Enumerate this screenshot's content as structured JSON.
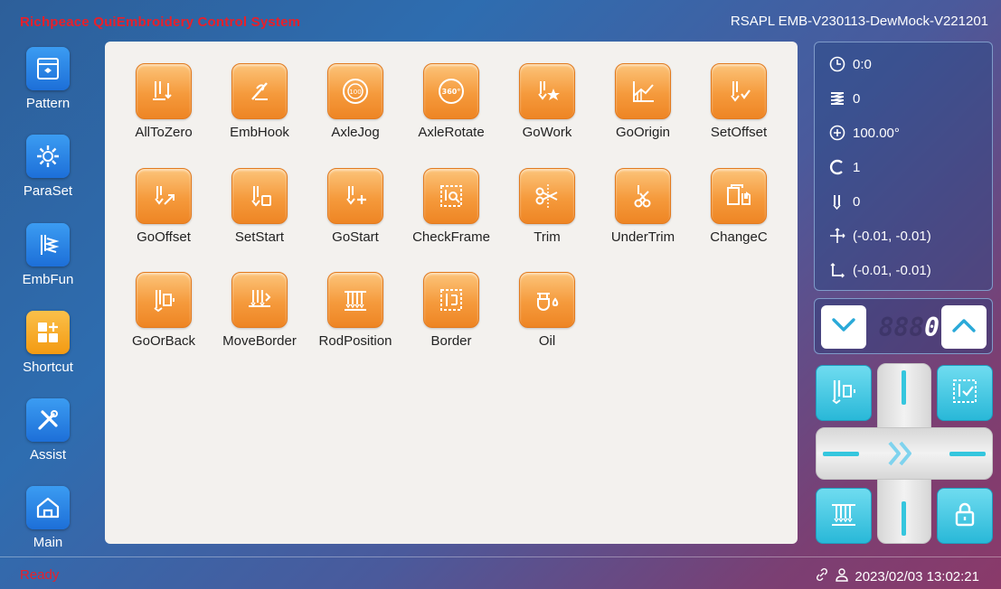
{
  "header": {
    "app_title": "Richpeace QuiEmbroidery Control System",
    "version": "RSAPL EMB-V230113-DewMock-V221201"
  },
  "sidebar": {
    "items": [
      {
        "label": "Pattern",
        "icon": "pattern-folder-icon"
      },
      {
        "label": "ParaSet",
        "icon": "gear-icon"
      },
      {
        "label": "EmbFun",
        "icon": "embroidery-function-icon"
      },
      {
        "label": "Shortcut",
        "icon": "shortcut-grid-icon",
        "active": true
      },
      {
        "label": "Assist",
        "icon": "tools-icon"
      },
      {
        "label": "Main",
        "icon": "home-icon"
      }
    ]
  },
  "functions": [
    {
      "label": "AllToZero",
      "icon": "all-to-zero-icon"
    },
    {
      "label": "EmbHook",
      "icon": "emb-hook-icon"
    },
    {
      "label": "AxleJog",
      "icon": "axle-jog-icon"
    },
    {
      "label": "AxleRotate",
      "icon": "axle-rotate-icon"
    },
    {
      "label": "GoWork",
      "icon": "go-work-icon"
    },
    {
      "label": "GoOrigin",
      "icon": "go-origin-icon"
    },
    {
      "label": "SetOffset",
      "icon": "set-offset-icon"
    },
    {
      "label": "GoOffset",
      "icon": "go-offset-icon"
    },
    {
      "label": "SetStart",
      "icon": "set-start-icon"
    },
    {
      "label": "GoStart",
      "icon": "go-start-icon"
    },
    {
      "label": "CheckFrame",
      "icon": "check-frame-icon"
    },
    {
      "label": "Trim",
      "icon": "trim-scissors-icon"
    },
    {
      "label": "UnderTrim",
      "icon": "under-trim-icon"
    },
    {
      "label": "ChangeC",
      "icon": "change-color-icon"
    },
    {
      "label": "GoOrBack",
      "icon": "go-or-back-icon"
    },
    {
      "label": "MoveBorder",
      "icon": "move-border-icon"
    },
    {
      "label": "RodPosition",
      "icon": "rod-position-icon"
    },
    {
      "label": "Border",
      "icon": "border-icon"
    },
    {
      "label": "Oil",
      "icon": "oil-icon"
    }
  ],
  "info": {
    "time": "0:0",
    "stitches": "0",
    "angle": "100.00°",
    "color": "1",
    "needle": "0",
    "position": "(-0.01, -0.01)",
    "origin": "(-0.01, -0.01)"
  },
  "counter": {
    "ghost_digits": "888",
    "value": "0"
  },
  "status": {
    "ready": "Ready",
    "datetime": "2023/02/03 13:02:21"
  },
  "colors": {
    "accent_orange": "#f59a3c",
    "accent_cyan": "#35c6de",
    "title_red": "#e8202a"
  }
}
